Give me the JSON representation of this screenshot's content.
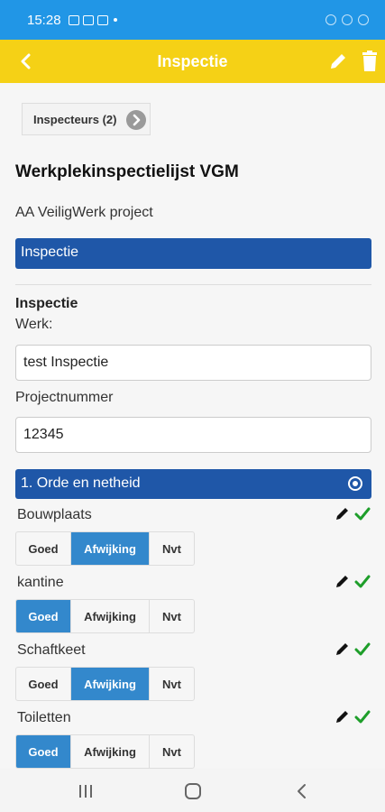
{
  "status": {
    "time": "15:28"
  },
  "appbar": {
    "title": "Inspectie"
  },
  "inspecteurs_label": "Inspecteurs (2)",
  "form": {
    "heading": "Werkplekinspectielijst VGM",
    "project": "AA VeiligWerk project",
    "inspectie_bar": "Inspectie",
    "inspectie_label": "Inspectie",
    "werk_label": "Werk:",
    "werk_value": "test Inspectie",
    "projectnummer_label": "Projectnummer",
    "projectnummer_value": "12345"
  },
  "section": {
    "title": "1. Orde en netheid"
  },
  "options": [
    "Goed",
    "Afwijking",
    "Nvt"
  ],
  "items": [
    {
      "label": "Bouwplaats",
      "selected": "Afwijking"
    },
    {
      "label": "kantine",
      "selected": "Goed"
    },
    {
      "label": "Schaftkeet",
      "selected": "Afwijking"
    },
    {
      "label": "Toiletten",
      "selected": "Goed"
    }
  ],
  "colors": {
    "statusbar": "#2196e6",
    "appbar": "#f5d116",
    "section": "#1f57a8",
    "active": "#3388cc",
    "check": "#1e9e2a"
  }
}
